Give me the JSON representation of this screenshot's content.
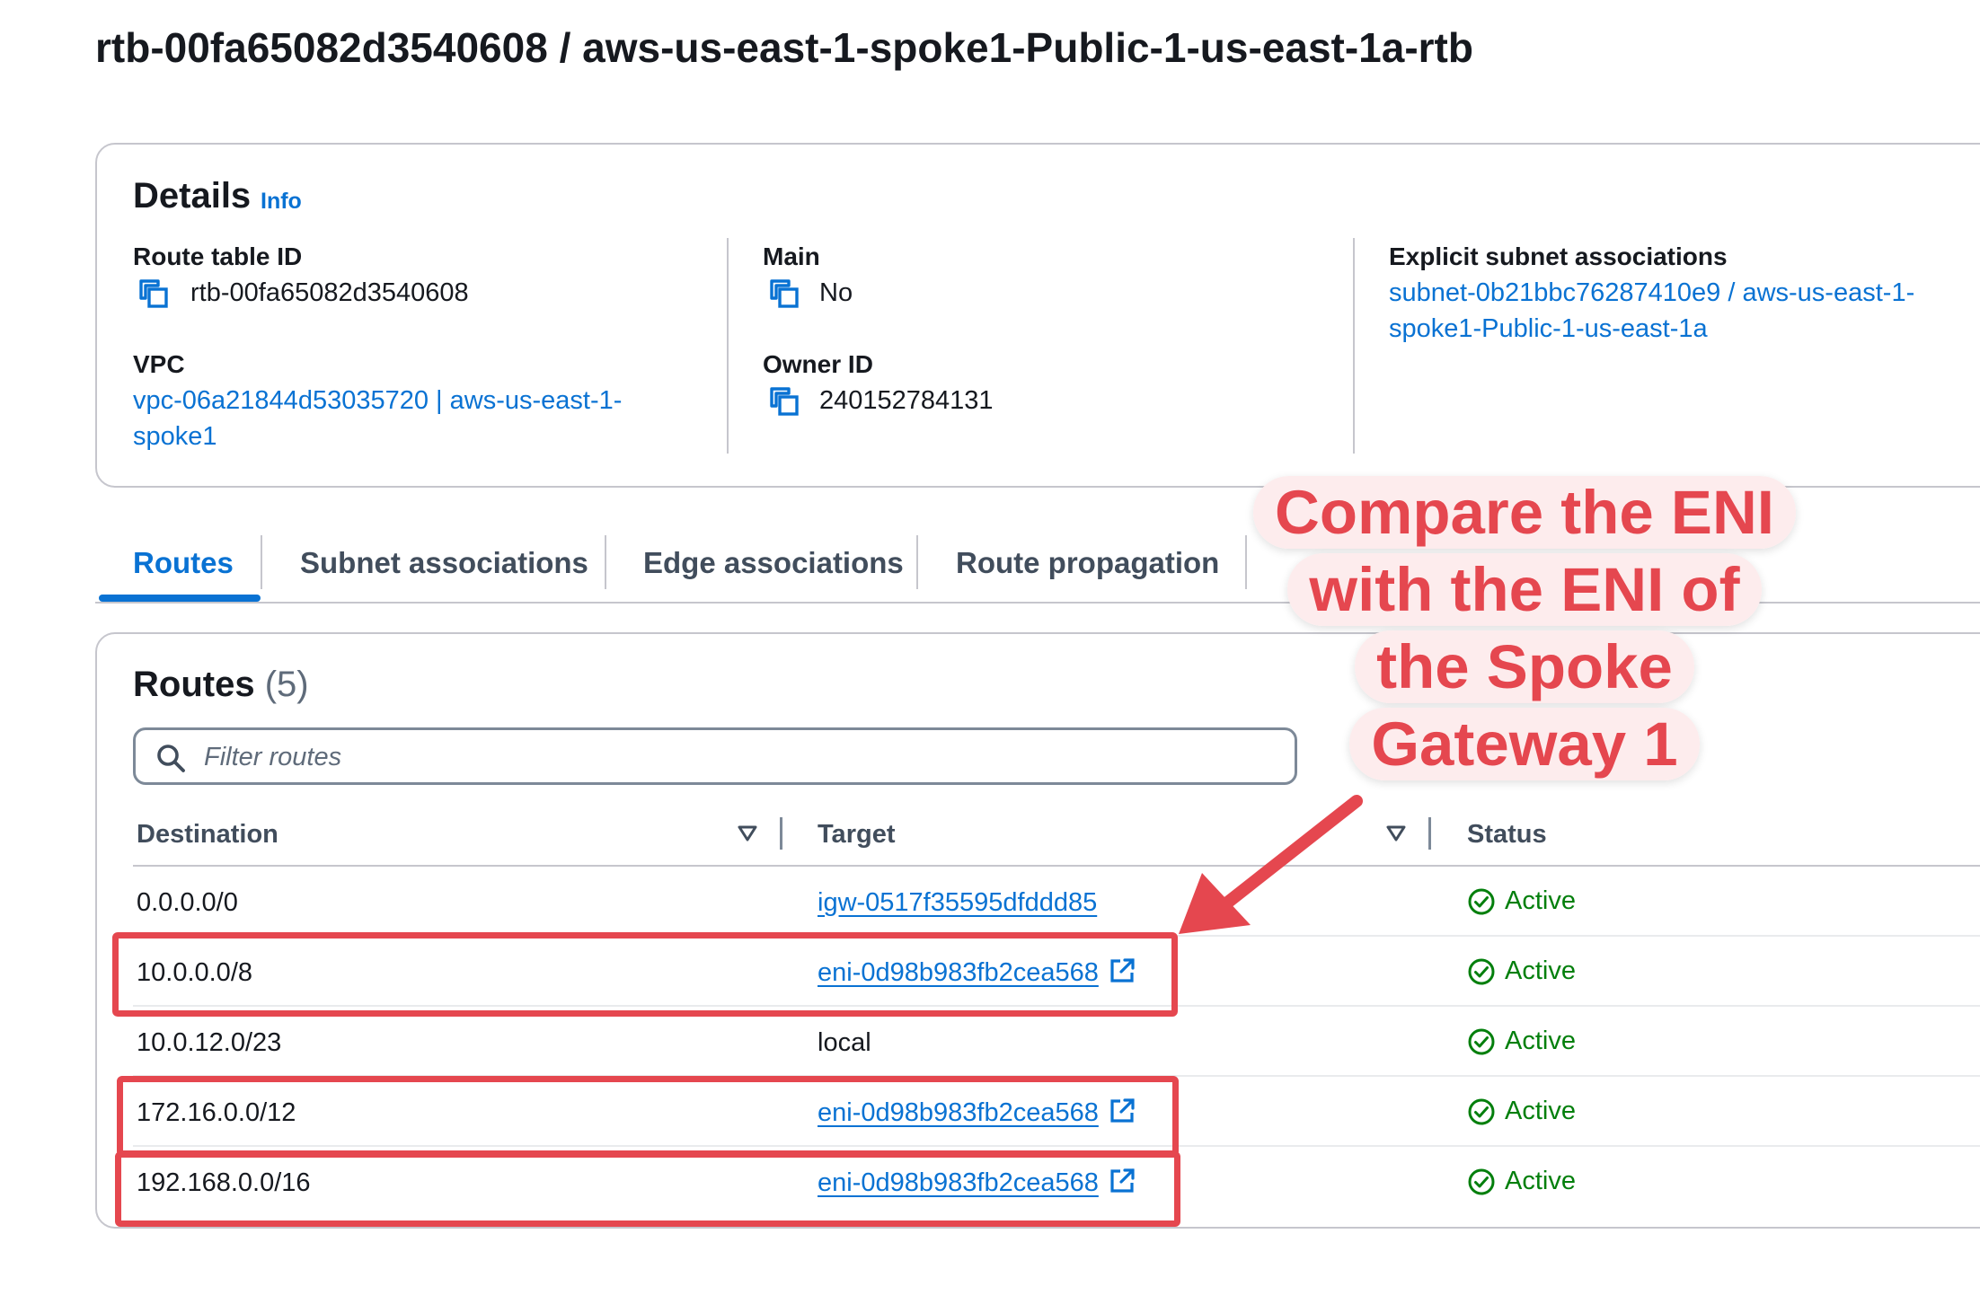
{
  "page": {
    "title": "rtb-00fa65082d3540608 / aws-us-east-1-spoke1-Public-1-us-east-1a-rtb"
  },
  "details": {
    "title": "Details",
    "info_label": "Info",
    "route_table_id_label": "Route table ID",
    "route_table_id": "rtb-00fa65082d3540608",
    "vpc_label": "VPC",
    "vpc_value": "vpc-06a21844d53035720 | aws-us-east-1-spoke1",
    "main_label": "Main",
    "main_value": "No",
    "owner_id_label": "Owner ID",
    "owner_id": "240152784131",
    "explicit_subnet_label": "Explicit subnet associations",
    "explicit_subnet_value": "subnet-0b21bbc76287410e9 / aws-us-east-1-spoke1-Public-1-us-east-1a"
  },
  "tabs": [
    {
      "label": "Routes",
      "active": true
    },
    {
      "label": "Subnet associations",
      "active": false
    },
    {
      "label": "Edge associations",
      "active": false
    },
    {
      "label": "Route propagation",
      "active": false
    }
  ],
  "routes": {
    "title": "Routes",
    "count": "(5)",
    "filter_placeholder": "Filter routes",
    "columns": {
      "destination": "Destination",
      "target": "Target",
      "status": "Status"
    },
    "rows": [
      {
        "destination": "0.0.0.0/0",
        "target": "igw-0517f35595dfddd85",
        "target_is_link": true,
        "external": false,
        "status": "Active"
      },
      {
        "destination": "10.0.0.0/8",
        "target": "eni-0d98b983fb2cea568",
        "target_is_link": true,
        "external": true,
        "status": "Active"
      },
      {
        "destination": "10.0.12.0/23",
        "target": "local",
        "target_is_link": false,
        "external": false,
        "status": "Active"
      },
      {
        "destination": "172.16.0.0/12",
        "target": "eni-0d98b983fb2cea568",
        "target_is_link": true,
        "external": true,
        "status": "Active"
      },
      {
        "destination": "192.168.0.0/16",
        "target": "eni-0d98b983fb2cea568",
        "target_is_link": true,
        "external": true,
        "status": "Active"
      }
    ]
  },
  "annotation": {
    "lines": [
      "Compare the ENI",
      "with the ENI of",
      "the Spoke",
      "Gateway 1"
    ]
  },
  "colors": {
    "link": "#0972d3",
    "status_active": "#037f0c",
    "annotation": "#e5474f",
    "annotation_bg": "#fdeced"
  }
}
